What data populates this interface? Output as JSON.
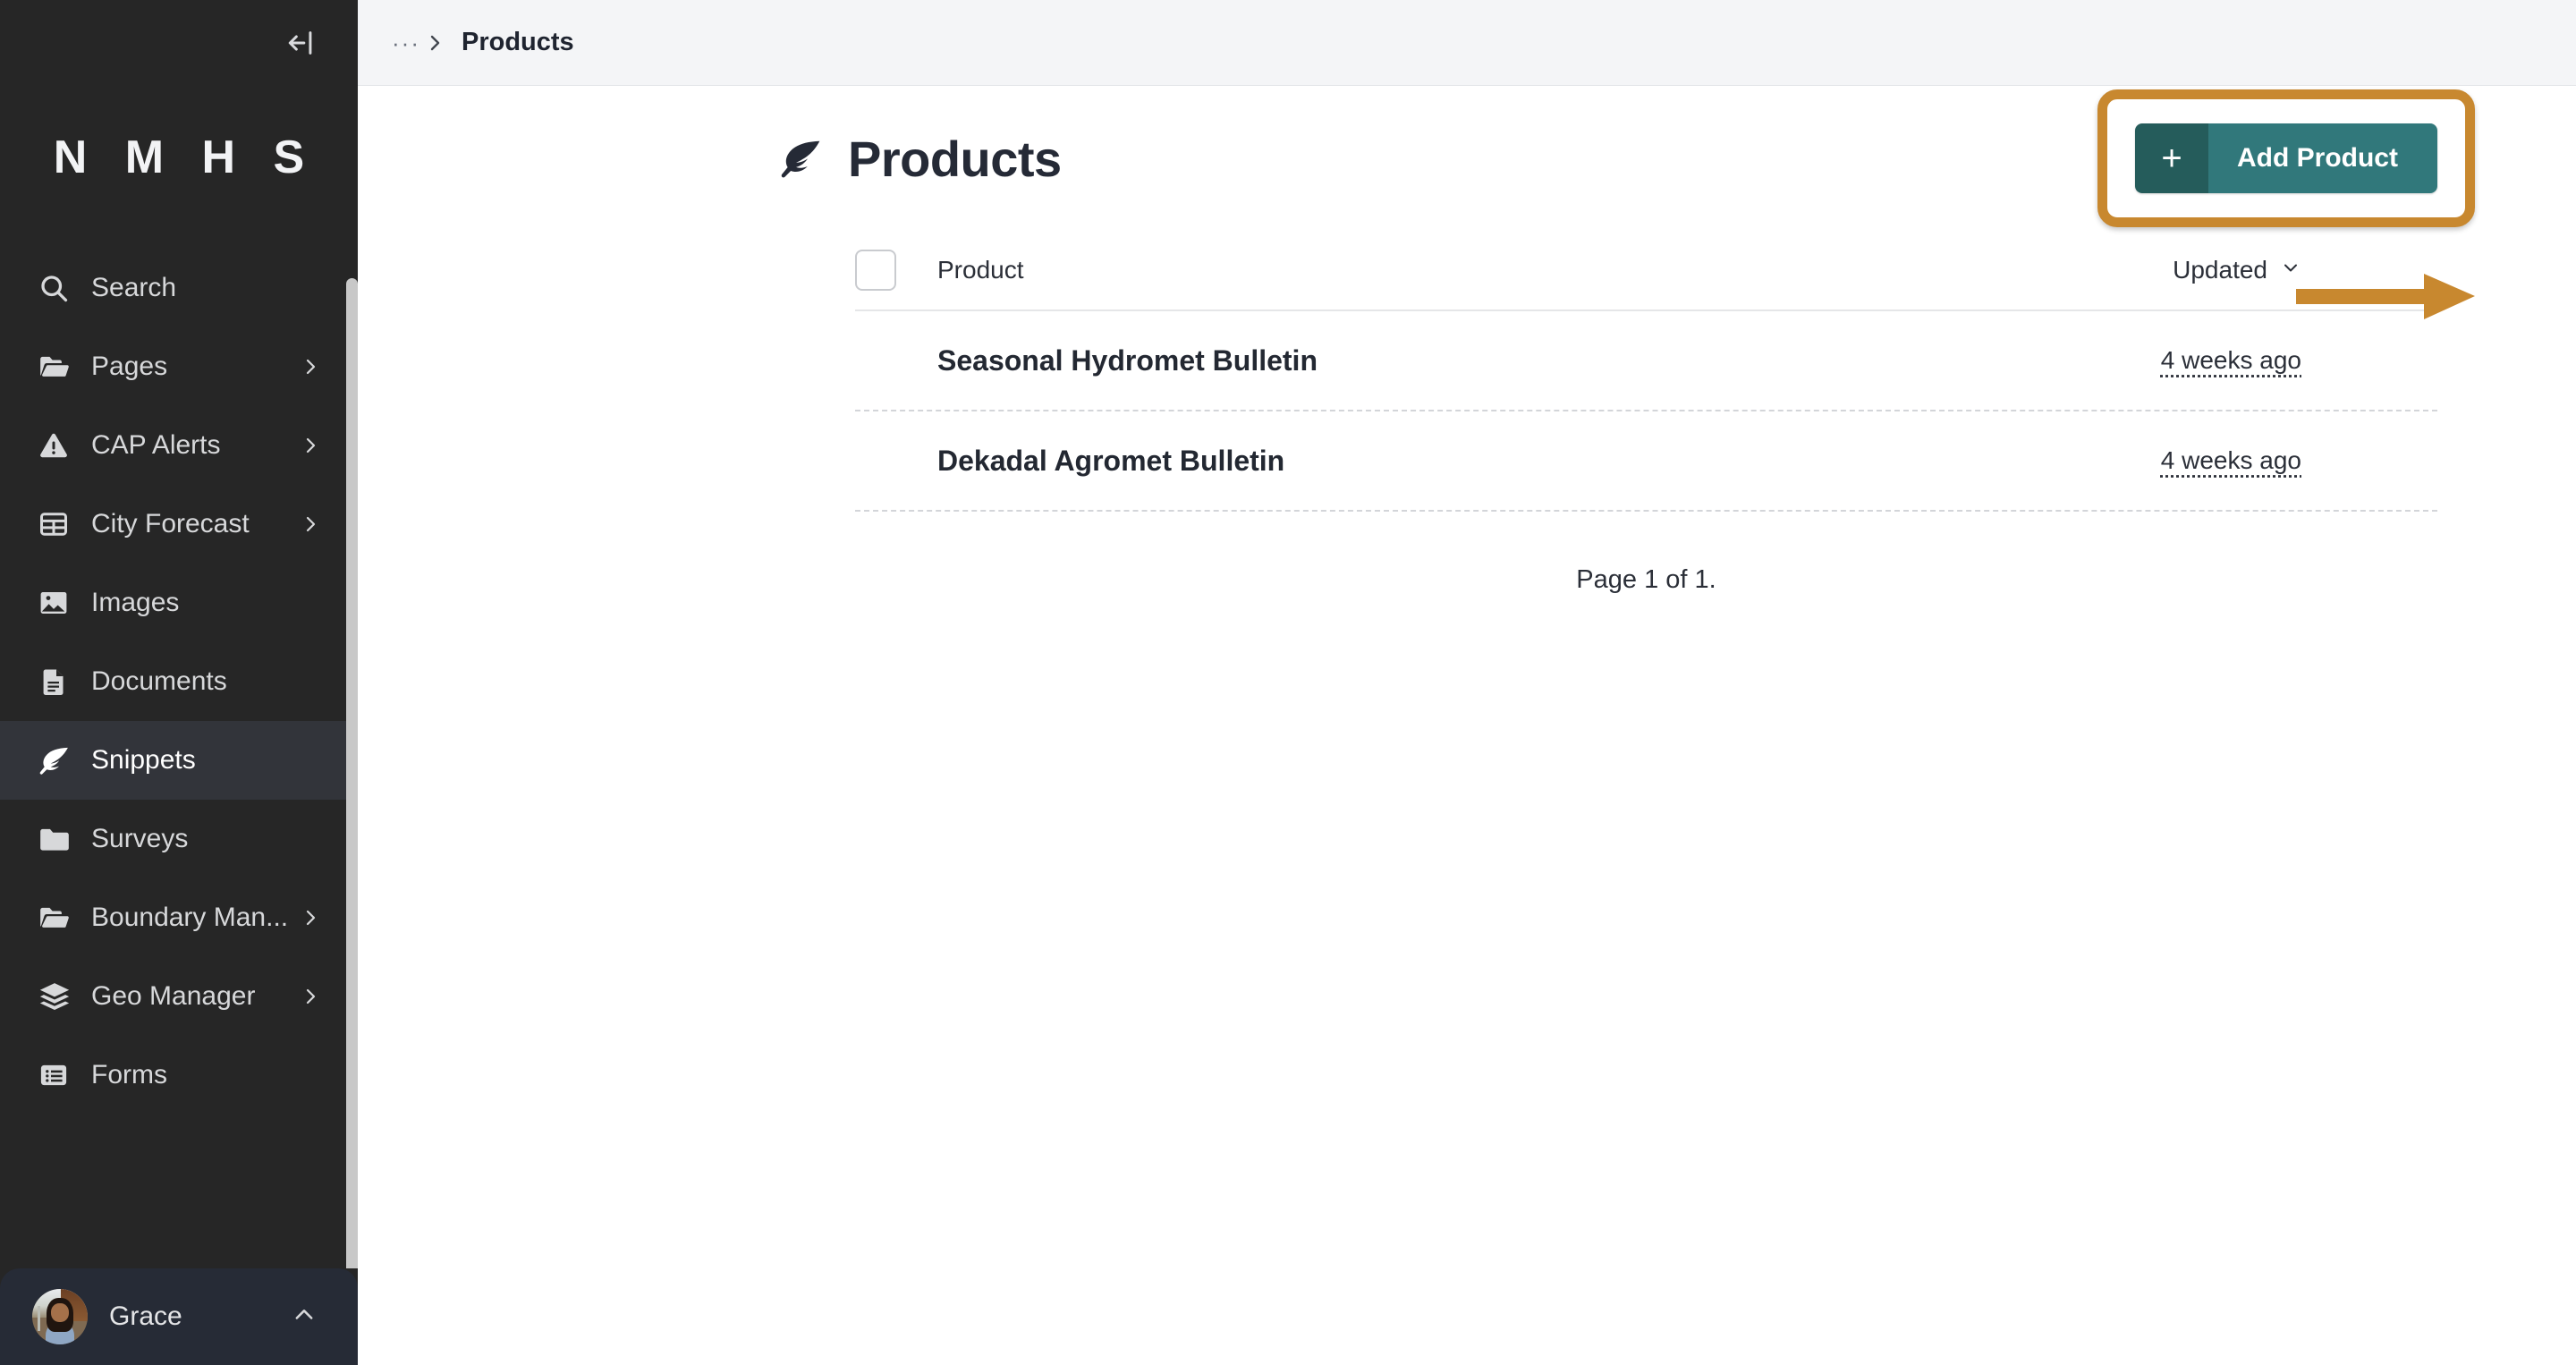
{
  "sidebar": {
    "collapse_icon": "collapse-left-icon",
    "brand": "N M H S",
    "scrollbar": "sidebar-scrollbar",
    "items": [
      {
        "label": "Search",
        "icon": "search-icon",
        "chevron": false,
        "active": false
      },
      {
        "label": "Pages",
        "icon": "folder-open-icon",
        "chevron": true,
        "active": false
      },
      {
        "label": "CAP Alerts",
        "icon": "warning-icon",
        "chevron": true,
        "active": false
      },
      {
        "label": "City Forecast",
        "icon": "table-icon",
        "chevron": true,
        "active": false
      },
      {
        "label": "Images",
        "icon": "image-icon",
        "chevron": false,
        "active": false
      },
      {
        "label": "Documents",
        "icon": "document-icon",
        "chevron": false,
        "active": false
      },
      {
        "label": "Snippets",
        "icon": "leaf-icon",
        "chevron": false,
        "active": true
      },
      {
        "label": "Surveys",
        "icon": "folder-icon",
        "chevron": false,
        "active": false
      },
      {
        "label": "Boundary Man...",
        "icon": "folder-open-icon",
        "chevron": true,
        "active": false
      },
      {
        "label": "Geo Manager",
        "icon": "layers-icon",
        "chevron": true,
        "active": false
      },
      {
        "label": "Forms",
        "icon": "list-icon",
        "chevron": false,
        "active": false
      }
    ],
    "profile": {
      "name": "Grace",
      "avatar": "user-avatar",
      "chevron_icon": "chevron-up-icon"
    }
  },
  "topbar": {
    "breadcrumb_ellipsis": "···",
    "breadcrumb_separator": "chevron-right-icon",
    "current": "Products"
  },
  "page": {
    "icon": "leaf-icon",
    "title": "Products",
    "add_button": {
      "plus": "+",
      "label": "Add Product"
    },
    "annotation": {
      "highlight_color": "#c8882f",
      "arrow_color": "#c8882f",
      "arrow_icon": "right-arrow-annotation"
    }
  },
  "table": {
    "select_all": "select-all-checkbox",
    "columns": {
      "product": "Product",
      "updated": "Updated",
      "sort_icon": "chevron-down-icon"
    },
    "rows": [
      {
        "product": "Seasonal Hydromet Bulletin",
        "updated": "4 weeks ago"
      },
      {
        "product": "Dekadal Agromet Bulletin",
        "updated": "4 weeks ago"
      }
    ]
  },
  "pagination": {
    "text": "Page 1 of 1."
  },
  "colors": {
    "sidebar_bg": "#262626",
    "sidebar_active": "#32343a",
    "profile_bg": "#262b36",
    "accent_teal_dark": "#255c5b",
    "accent_teal": "#31787b",
    "annotation_gold": "#c8882f",
    "topbar_bg": "#f4f5f7"
  }
}
